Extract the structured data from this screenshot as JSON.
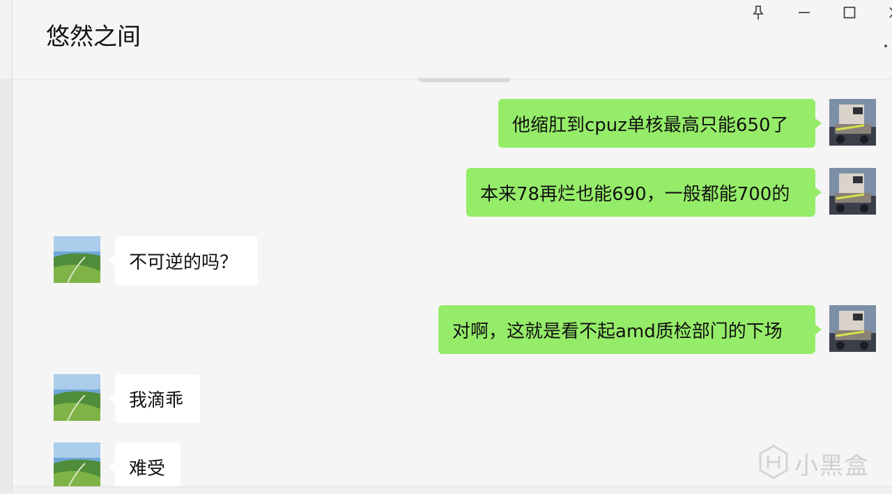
{
  "window": {
    "title": "悠然之间",
    "buttons": [
      "pin-icon",
      "minimize-icon",
      "maximize-icon",
      "close-icon"
    ]
  },
  "colors": {
    "outgoing_bubble": "#95ec69",
    "incoming_bubble": "#ffffff",
    "background": "#f5f5f5"
  },
  "messages": [
    {
      "side": "out",
      "text": "他缩肛到cpuz单核最高只能650了"
    },
    {
      "side": "out",
      "text": "本来78再烂也能690，一般都能700的"
    },
    {
      "side": "in",
      "text": "不可逆的吗？"
    },
    {
      "side": "out",
      "text": "对啊，这就是看不起amd质检部门的下场"
    },
    {
      "side": "in",
      "text": "我滴乖"
    },
    {
      "side": "in",
      "text": "难受"
    }
  ],
  "watermark": {
    "text": "小黑盒"
  }
}
